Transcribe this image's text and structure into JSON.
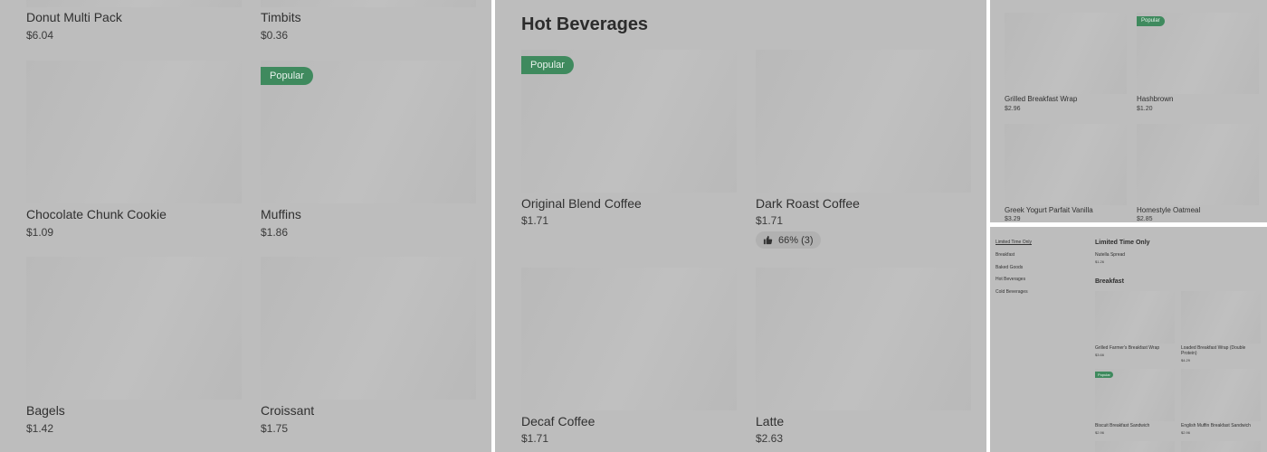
{
  "panel1": {
    "items": [
      {
        "name": "Donut Multi Pack",
        "price": "$6.04"
      },
      {
        "name": "Timbits",
        "price": "$0.36"
      },
      {
        "name": "Chocolate Chunk Cookie",
        "price": "$1.09"
      },
      {
        "name": "Muffins",
        "price": "$1.86",
        "badge": "Popular"
      },
      {
        "name": "Bagels",
        "price": "$1.42"
      },
      {
        "name": "Croissant",
        "price": "$1.75"
      }
    ]
  },
  "panel2": {
    "heading": "Hot Beverages",
    "items": [
      {
        "name": "Original Blend Coffee",
        "price": "$1.71",
        "badge": "Popular"
      },
      {
        "name": "Dark Roast Coffee",
        "price": "$1.71",
        "rating": "66% (3)"
      },
      {
        "name": "Decaf Coffee",
        "price": "$1.71"
      },
      {
        "name": "Latte",
        "price": "$2.63"
      }
    ]
  },
  "panel3": {
    "items": [
      {
        "name": "Grilled Breakfast Wrap",
        "price": "$2.96"
      },
      {
        "name": "Hashbrown",
        "price": "$1.20",
        "badge": "Popular"
      },
      {
        "name": "Greek Yogurt Parfait Vanilla",
        "price": "$3.29"
      },
      {
        "name": "Homestyle Oatmeal",
        "price": "$2.85"
      }
    ]
  },
  "panel4": {
    "nav": [
      "Limited Time Only",
      "Breakfast",
      "Baked Goods",
      "Hot Beverages",
      "Cold Beverages"
    ],
    "limited_heading": "Limited Time Only",
    "limited_item": {
      "name": "Nutella Spread",
      "price": "$1.26"
    },
    "breakfast_heading": "Breakfast",
    "items": [
      {
        "name": "Grilled Farmer's Breakfast Wrap",
        "price": "$3.66"
      },
      {
        "name": "Loaded Breakfast Wrap (Double Protein)",
        "price": "$4.29"
      },
      {
        "name": "Biscuit Breakfast Sandwich",
        "price": "$2.96",
        "badge": "Popular"
      },
      {
        "name": "English Muffin Breakfast Sandwich",
        "price": "$2.96"
      }
    ]
  },
  "colors": {
    "badge": "#3f8a5e",
    "overlay": "#bdbdbd",
    "placeholder": "#b9b9b9"
  },
  "icons": {
    "rating": "thumbs-up-icon"
  }
}
